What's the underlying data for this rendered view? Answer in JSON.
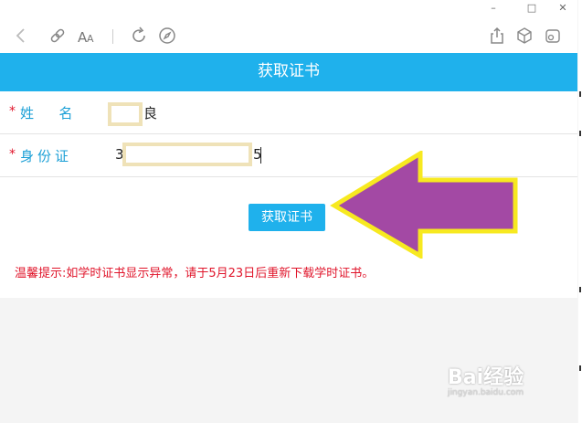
{
  "header": {
    "title": "获取证书"
  },
  "form": {
    "name": {
      "label": "姓  名",
      "value_suffix": "良"
    },
    "id": {
      "label": "身份证",
      "value_prefix": "3",
      "value_suffix": "5"
    }
  },
  "button": {
    "label": "获取证书"
  },
  "notice": "温馨提示:如学时证书显示异常，请于5月23日后重新下载学时证书。",
  "watermark": {
    "brand": "Bai经验",
    "url": "jingyan.baidu.com"
  },
  "colors": {
    "accent": "#1fb1ec",
    "warning": "#e0142a",
    "arrow_fill": "#a349a4",
    "arrow_stroke": "#f7e920"
  },
  "icons": [
    "back-icon",
    "link-icon",
    "font-size-icon",
    "refresh-icon",
    "compass-icon",
    "share-icon",
    "cube-icon",
    "user-icon"
  ]
}
